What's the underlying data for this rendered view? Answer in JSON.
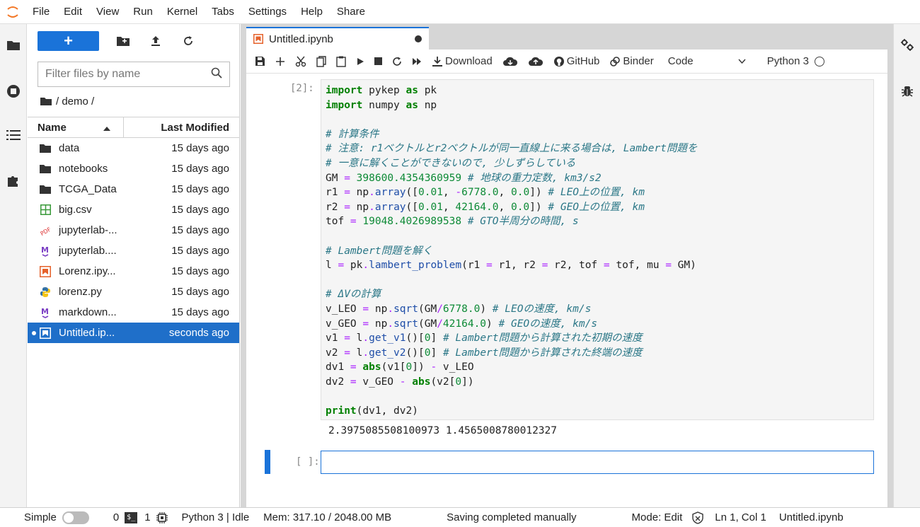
{
  "menubar": {
    "items": [
      "File",
      "Edit",
      "View",
      "Run",
      "Kernel",
      "Tabs",
      "Settings",
      "Help",
      "Share"
    ]
  },
  "filepanel": {
    "new_label": "+",
    "filter_placeholder": "Filter files by name",
    "breadcrumb": "/ demo /",
    "header_name": "Name",
    "header_modified": "Last Modified",
    "files": [
      {
        "name": "data",
        "modified": "15 days ago",
        "icon": "folder-icon"
      },
      {
        "name": "notebooks",
        "modified": "15 days ago",
        "icon": "folder-icon"
      },
      {
        "name": "TCGA_Data",
        "modified": "15 days ago",
        "icon": "folder-icon"
      },
      {
        "name": "big.csv",
        "modified": "15 days ago",
        "icon": "spreadsheet-icon"
      },
      {
        "name": "jupyterlab-...",
        "modified": "15 days ago",
        "icon": "pdf-icon"
      },
      {
        "name": "jupyterlab....",
        "modified": "15 days ago",
        "icon": "markdown-icon"
      },
      {
        "name": "Lorenz.ipy...",
        "modified": "15 days ago",
        "icon": "notebook-icon"
      },
      {
        "name": "lorenz.py",
        "modified": "15 days ago",
        "icon": "python-icon"
      },
      {
        "name": "markdown...",
        "modified": "15 days ago",
        "icon": "markdown-icon"
      },
      {
        "name": "Untitled.ip...",
        "modified": "seconds ago",
        "icon": "notebook-icon"
      }
    ]
  },
  "tab": {
    "title": "Untitled.ipynb"
  },
  "notebook_toolbar": {
    "download": "Download",
    "github": "GitHub",
    "binder": "Binder",
    "cell_type": "Code",
    "kernel": "Python 3"
  },
  "cells": {
    "cell1_prompt": "[2]:",
    "cell2_prompt": "[ ]:",
    "output": "2.3975085508100973 1.4565008780012327"
  },
  "statusbar": {
    "simple": "Simple",
    "count0": "0",
    "count1": "1",
    "kernel_status": "Python 3 | Idle",
    "mem": "Mem: 317.10 / 2048.00 MB",
    "saving": "Saving completed manually",
    "mode": "Mode: Edit",
    "position": "Ln 1, Col 1",
    "filename": "Untitled.ipynb"
  },
  "colors": {
    "accent": "#1a73d9",
    "selected": "#1f6fc9"
  }
}
